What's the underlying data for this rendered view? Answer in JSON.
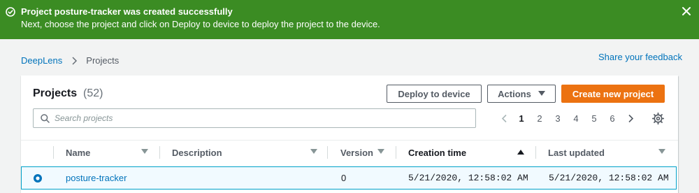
{
  "flash": {
    "title": "Project posture-tracker was created successfully",
    "message": "Next, choose the project and click on Deploy to device to deploy the project to the device.",
    "status_icon": "success-check-icon",
    "close_icon": "close-icon",
    "color": "#3b8c23"
  },
  "breadcrumb": {
    "items": [
      "DeepLens",
      "Projects"
    ]
  },
  "feedback_link": "Share your feedback",
  "panel": {
    "title": "Projects",
    "count": "(52)",
    "buttons": {
      "deploy": "Deploy to device",
      "actions": "Actions",
      "create": "Create new project"
    },
    "search": {
      "placeholder": "Search projects",
      "value": ""
    },
    "pagination": {
      "pages": [
        "1",
        "2",
        "3",
        "4",
        "5",
        "6"
      ],
      "current": "1"
    },
    "table": {
      "columns": [
        {
          "label": "Name",
          "sort": "none"
        },
        {
          "label": "Description",
          "sort": "none"
        },
        {
          "label": "Version",
          "sort": "none"
        },
        {
          "label": "Creation time",
          "sort": "ascending"
        },
        {
          "label": "Last updated",
          "sort": "none"
        }
      ],
      "rows": [
        {
          "selected": true,
          "name": "posture-tracker",
          "description": "",
          "version": "0",
          "creation_time": "5/21/2020, 12:58:02 AM",
          "last_updated": "5/21/2020, 12:58:02 AM"
        }
      ]
    }
  },
  "colors": {
    "accent": "#ec7211",
    "link": "#0073bb",
    "selection": "#00a1c9"
  }
}
